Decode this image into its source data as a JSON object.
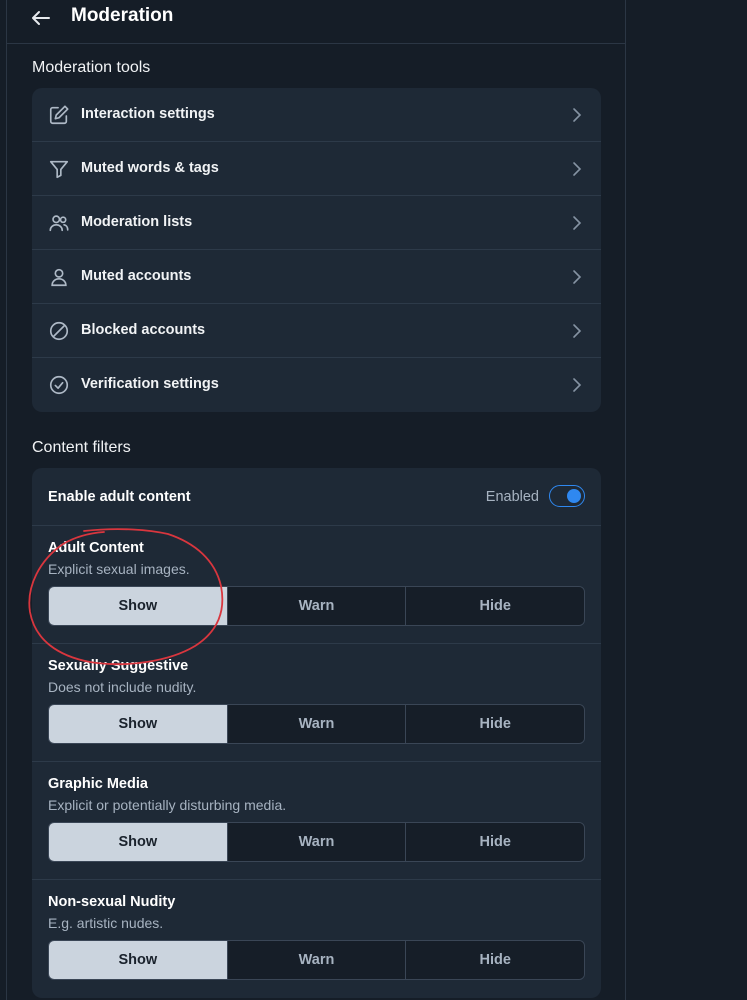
{
  "header": {
    "title": "Moderation",
    "back_icon": "arrow-left-icon"
  },
  "moderation_tools": {
    "title": "Moderation tools",
    "items": [
      {
        "label": "Interaction settings",
        "icon": "edit-icon"
      },
      {
        "label": "Muted words & tags",
        "icon": "filter-icon"
      },
      {
        "label": "Moderation lists",
        "icon": "users-icon"
      },
      {
        "label": "Muted accounts",
        "icon": "person-icon"
      },
      {
        "label": "Blocked accounts",
        "icon": "block-icon"
      },
      {
        "label": "Verification settings",
        "icon": "check-circle-icon"
      }
    ]
  },
  "content_filters": {
    "title": "Content filters",
    "adult": {
      "label": "Enable adult content",
      "state": "Enabled",
      "enabled": true
    },
    "options": [
      "Show",
      "Warn",
      "Hide"
    ],
    "filters": [
      {
        "name": "Adult Content",
        "description": "Explicit sexual images.",
        "selected": "Show"
      },
      {
        "name": "Sexually Suggestive",
        "description": "Does not include nudity.",
        "selected": "Show"
      },
      {
        "name": "Graphic Media",
        "description": "Explicit or potentially disturbing media.",
        "selected": "Show"
      },
      {
        "name": "Non-sexual Nudity",
        "description": "E.g. artistic nudes.",
        "selected": "Show"
      }
    ]
  },
  "colors": {
    "accent": "#2f88f0",
    "selected_bg": "#cbd4de",
    "annotation": "#d9363e"
  }
}
